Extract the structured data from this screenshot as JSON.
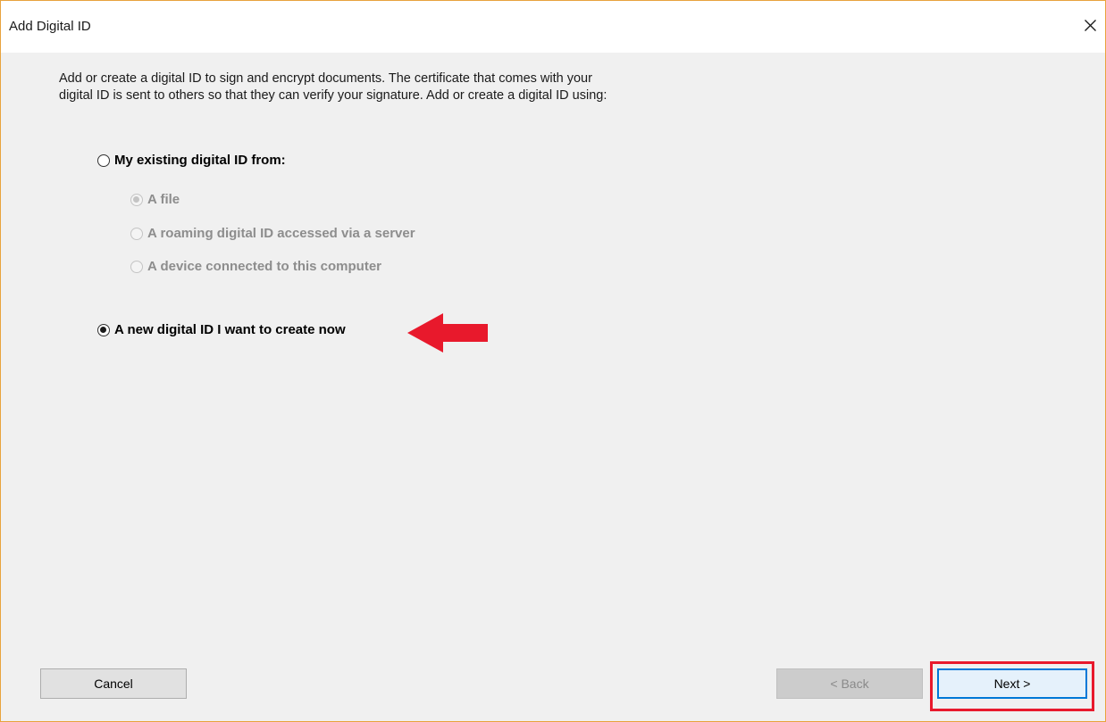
{
  "dialog": {
    "title": "Add Digital ID",
    "close_glyph": "✕",
    "close_icon": "close-icon"
  },
  "intro": {
    "line1": "Add or create a digital ID to sign and encrypt documents. The certificate that comes with your",
    "line2": "digital ID is sent to others so that they can verify your signature. Add or create a digital ID using:"
  },
  "options": {
    "existing": {
      "label": "My existing digital ID from:",
      "selected": false,
      "enabled": true
    },
    "sub_options": [
      {
        "label": "A file",
        "selected": true,
        "enabled": false
      },
      {
        "label": "A roaming digital ID accessed via a server",
        "selected": false,
        "enabled": false
      },
      {
        "label": "A device connected to this computer",
        "selected": false,
        "enabled": false
      }
    ],
    "new_id": {
      "label": "A new digital ID I want to create now",
      "selected": true,
      "enabled": true
    }
  },
  "buttons": {
    "cancel": "Cancel",
    "back": "< Back",
    "next": "Next >"
  },
  "annotations": {
    "arrow_color": "#e8192c",
    "highlight_color": "#e8192c"
  },
  "colors": {
    "accent": "#0078d7",
    "window_border": "#e8a33d",
    "background": "#f0f0f0"
  }
}
